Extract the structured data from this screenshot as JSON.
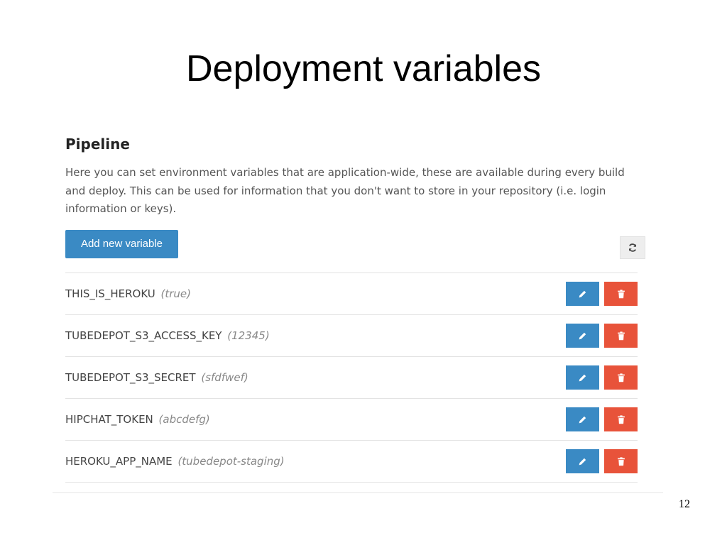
{
  "slide": {
    "title": "Deployment variables",
    "page_number": "12"
  },
  "panel": {
    "heading": "Pipeline",
    "description": "Here you can set environment variables that are application-wide, these are available during every build and deploy. This can be used for information that you don't want to store in your repository (i.e. login information or keys).",
    "add_button_label": "Add new variable",
    "refresh_icon": "refresh-icon"
  },
  "variables": [
    {
      "name": "THIS_IS_HEROKU",
      "value": "(true)"
    },
    {
      "name": "TUBEDEPOT_S3_ACCESS_KEY",
      "value": "(12345)"
    },
    {
      "name": "TUBEDEPOT_S3_SECRET",
      "value": "(sfdfwef)"
    },
    {
      "name": "HIPCHAT_TOKEN",
      "value": "(abcdefg)"
    },
    {
      "name": "HEROKU_APP_NAME",
      "value": "(tubedepot-staging)"
    }
  ],
  "row_actions": {
    "edit_icon": "pencil-icon",
    "delete_icon": "trash-icon"
  },
  "colors": {
    "primary": "#3a8ac4",
    "danger": "#e8533a",
    "text": "#444444",
    "muted": "#888888"
  }
}
